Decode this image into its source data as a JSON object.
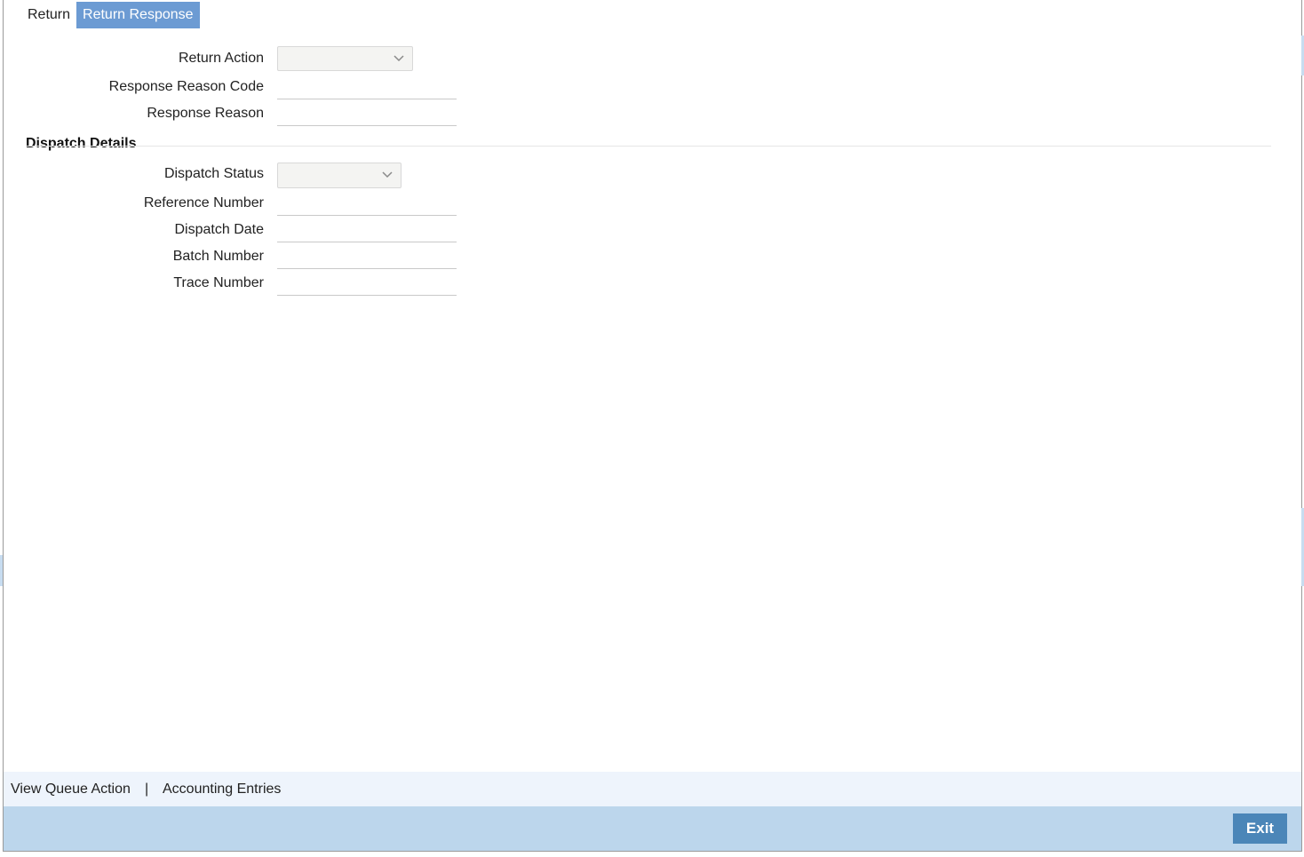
{
  "tabs": [
    {
      "label": "Return",
      "active": false
    },
    {
      "label": "Return Response",
      "active": true
    }
  ],
  "response": {
    "return_action": {
      "label": "Return Action",
      "value": ""
    },
    "response_reason_code": {
      "label": "Response Reason Code",
      "value": ""
    },
    "response_reason": {
      "label": "Response Reason",
      "value": ""
    }
  },
  "dispatch": {
    "title": "Dispatch Details",
    "dispatch_status": {
      "label": "Dispatch Status",
      "value": ""
    },
    "reference_number": {
      "label": "Reference Number",
      "value": ""
    },
    "dispatch_date": {
      "label": "Dispatch Date",
      "value": ""
    },
    "batch_number": {
      "label": "Batch Number",
      "value": ""
    },
    "trace_number": {
      "label": "Trace Number",
      "value": ""
    }
  },
  "bottom_links": {
    "view_queue_action": "View Queue Action",
    "separator": "|",
    "accounting_entries": "Accounting Entries"
  },
  "footer": {
    "exit_label": "Exit"
  },
  "colors": {
    "active_tab": "#6c9bd3",
    "links_bar": "#eef4fc",
    "footer_bar": "#bcd6ec",
    "exit_button": "#4b86b8"
  }
}
